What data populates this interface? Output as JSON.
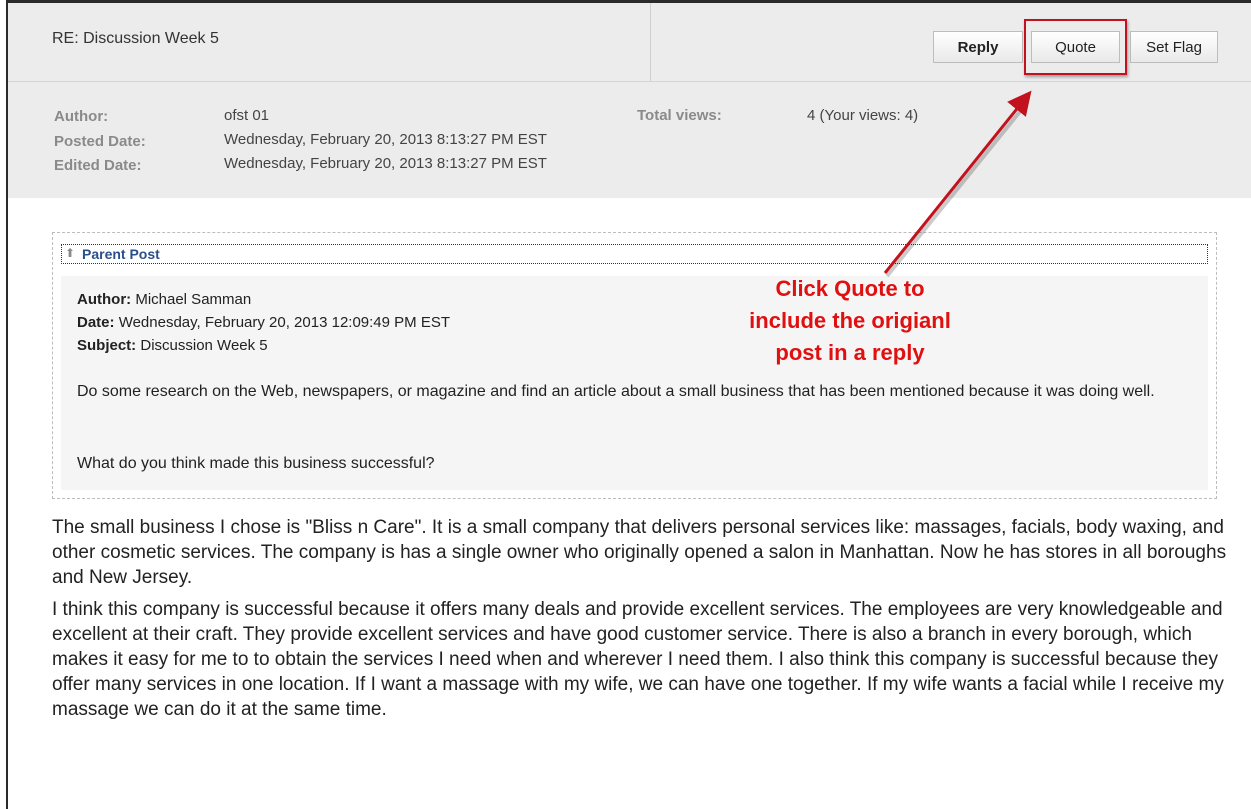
{
  "header": {
    "subject": "RE: Discussion Week 5",
    "buttons": {
      "reply": "Reply",
      "quote": "Quote",
      "set_flag": "Set Flag"
    }
  },
  "meta": {
    "author_label": "Author:",
    "author_value": "ofst 01",
    "posted_label": "Posted Date:",
    "posted_value": "Wednesday, February 20, 2013 8:13:27 PM EST",
    "edited_label": "Edited Date:",
    "edited_value": "Wednesday, February 20, 2013 8:13:27 PM EST",
    "views_label": "Total views:",
    "views_value": "4 (Your views: 4)"
  },
  "parent_post": {
    "title": "Parent Post",
    "author_label": "Author:",
    "author_value": "Michael Samman",
    "date_label": "Date:",
    "date_value": "Wednesday, February 20, 2013 12:09:49 PM EST",
    "subject_label": "Subject:",
    "subject_value": "Discussion Week 5",
    "body_1": "Do some research on the Web, newspapers, or magazine and find an article about a small business that has been mentioned because it was doing well.",
    "body_2": "What do you think made this business successful?"
  },
  "annotation": {
    "line1": "Click Quote to",
    "line2": "include the origianl",
    "line3": "post in a reply"
  },
  "reply": {
    "paragraph_1": "The small business I chose is \"Bliss n Care\". It is a small company that delivers personal services like: massages, facials, body waxing, and other cosmetic services. The company is has a single owner who originally opened a salon in Manhattan. Now he has stores in all boroughs and New Jersey.",
    "paragraph_2": "I think this company is successful because it offers many deals and provide excellent services. The employees are very knowledgeable and excellent at their craft. They provide excellent services and have good customer service. There is also a branch in every borough, which makes it easy for me to to obtain the services I need when and wherever I need them. I also think this company is successful because they offer many services in one location. If I want a massage with my wife, we can have one together. If my wife wants a facial while I receive my massage we can do it at the same time."
  },
  "colors": {
    "annotation_red": "#e01010",
    "highlight_border": "#c2121d",
    "link_blue": "#2b4f8a",
    "header_gray": "#ececec"
  }
}
